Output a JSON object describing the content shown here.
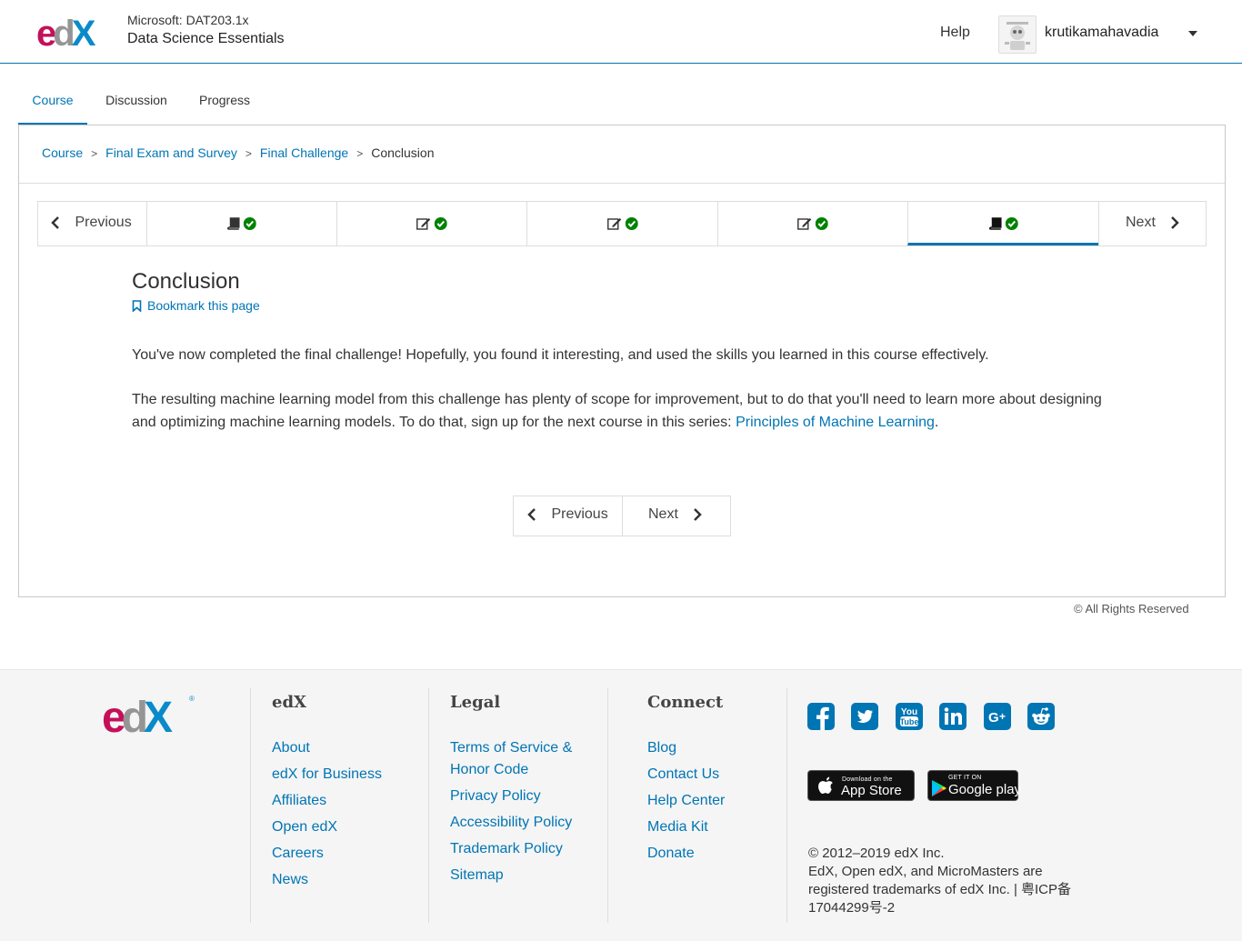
{
  "header": {
    "logo_text": "edX",
    "course_org": "Microsoft: DAT203.1x",
    "course_title": "Data Science Essentials",
    "help_label": "Help",
    "username": "krutikamahavadia"
  },
  "tabs": [
    {
      "label": "Course",
      "active": true
    },
    {
      "label": "Discussion",
      "active": false
    },
    {
      "label": "Progress",
      "active": false
    }
  ],
  "breadcrumb": {
    "items": [
      "Course",
      "Final Exam and Survey",
      "Final Challenge"
    ],
    "current": "Conclusion"
  },
  "sequence_nav": {
    "previous_label": "Previous",
    "next_label": "Next",
    "units": [
      {
        "icon": "book-icon",
        "completed": true,
        "active": false
      },
      {
        "icon": "edit-icon",
        "completed": true,
        "active": false
      },
      {
        "icon": "edit-icon",
        "completed": true,
        "active": false
      },
      {
        "icon": "edit-icon",
        "completed": true,
        "active": false
      },
      {
        "icon": "book-icon",
        "completed": true,
        "active": true
      }
    ]
  },
  "unit": {
    "title": "Conclusion",
    "bookmark_label": "Bookmark this page",
    "paragraph1": "You've now completed the final challenge! Hopefully, you found it interesting, and used the skills you learned in this course effectively.",
    "paragraph2_text": "The resulting machine learning model from this challenge has plenty of scope for improvement, but to do that you'll need to learn more about designing and optimizing machine learning models. To do that, sign up for the next course in this series: ",
    "paragraph2_link": "Principles of Machine Learning",
    "paragraph2_end": "."
  },
  "bottom_nav": {
    "previous_label": "Previous",
    "next_label": "Next"
  },
  "rights": "© All Rights Reserved",
  "footer": {
    "logo_text": "edX",
    "columns": [
      {
        "heading": "edX",
        "links": [
          "About",
          "edX for Business",
          "Affiliates",
          "Open edX",
          "Careers",
          "News"
        ]
      },
      {
        "heading": "Legal",
        "links": [
          "Terms of Service & Honor Code",
          "Privacy Policy",
          "Accessibility Policy",
          "Trademark Policy",
          "Sitemap"
        ]
      },
      {
        "heading": "Connect",
        "links": [
          "Blog",
          "Contact Us",
          "Help Center",
          "Media Kit",
          "Donate"
        ]
      }
    ],
    "social_icons": [
      "facebook-icon",
      "twitter-icon",
      "youtube-icon",
      "linkedin-icon",
      "google-plus-icon",
      "reddit-icon"
    ],
    "app_store": {
      "small": "Download on the",
      "big": "App Store"
    },
    "google_play": {
      "small": "GET IT ON",
      "big": "Google play"
    },
    "copyright_lines": [
      "© 2012–2019 edX Inc.",
      "EdX, Open edX, and MicroMasters are",
      "registered trademarks of edX Inc. | 粤ICP备",
      "17044299号-2"
    ]
  },
  "colors": {
    "accent": "#0075b4",
    "check": "#008100",
    "social": "#0075b4",
    "logo_e": "#c4105b",
    "logo_d": "#959595",
    "logo_x": "#0a8ac9"
  }
}
